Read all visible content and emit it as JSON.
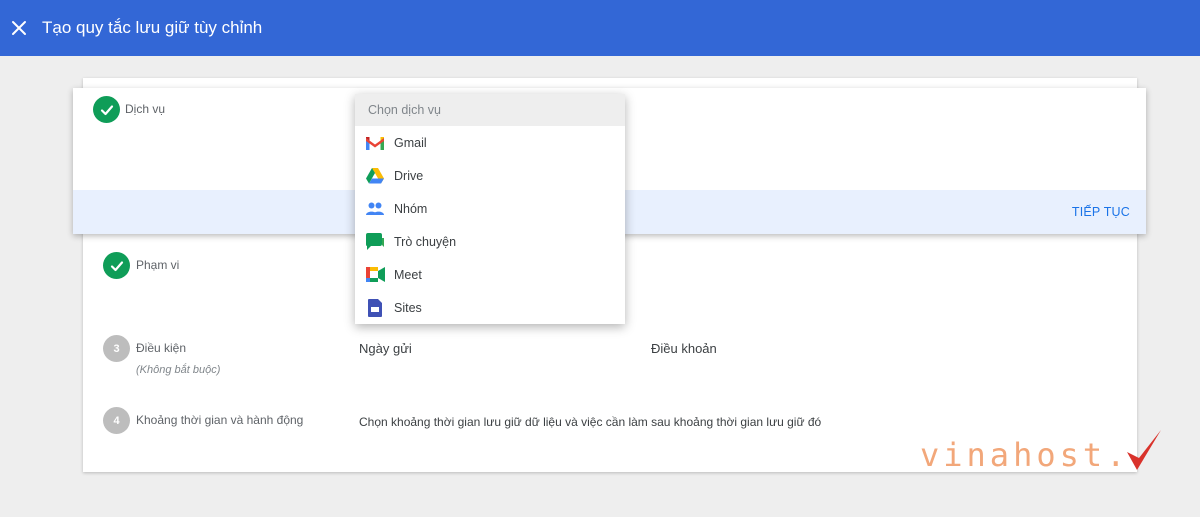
{
  "header": {
    "title": "Tạo quy tắc lưu giữ tùy chỉnh"
  },
  "steps": {
    "service": {
      "label": "Dịch vụ",
      "continue_label": "TIẾP TỤC"
    },
    "scope": {
      "label": "Phạm vi"
    },
    "conditions": {
      "number": "3",
      "label": "Điều kiện",
      "optional": "(Không bắt buộc)",
      "col1": "Ngày gửi",
      "col2": "Điều khoản"
    },
    "duration": {
      "number": "4",
      "label": "Khoảng thời gian và hành động",
      "description": "Chọn khoảng thời gian lưu giữ dữ liệu và việc cần làm sau khoảng thời gian lưu giữ đó"
    }
  },
  "dropdown": {
    "placeholder": "Chọn dịch vụ",
    "items": [
      {
        "label": "Gmail",
        "icon": "gmail-icon"
      },
      {
        "label": "Drive",
        "icon": "drive-icon"
      },
      {
        "label": "Nhóm",
        "icon": "groups-icon"
      },
      {
        "label": "Trò chuyện",
        "icon": "chat-icon"
      },
      {
        "label": "Meet",
        "icon": "meet-icon"
      },
      {
        "label": "Sites",
        "icon": "sites-icon"
      }
    ]
  },
  "watermark": {
    "text": "vinahost."
  },
  "colors": {
    "header_bg": "#3367d6",
    "check_green": "#0f9d58",
    "link_blue": "#1a73e8",
    "footer_tint": "#e8f0fe"
  }
}
